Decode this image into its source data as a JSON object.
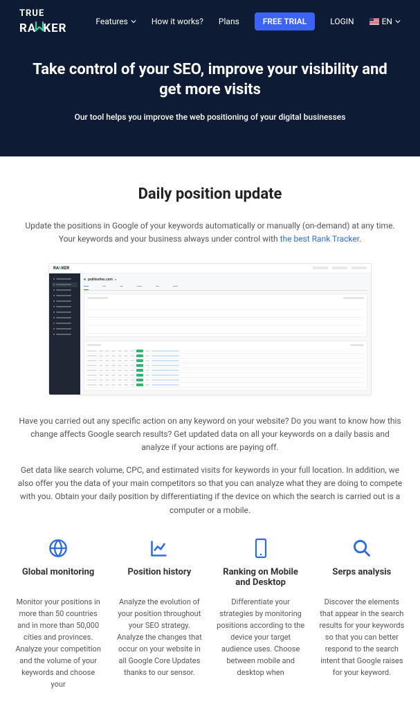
{
  "logo": {
    "line1": "TRUE",
    "line2": "RA",
    "line2b": "KER"
  },
  "nav": {
    "features": "Features",
    "how": "How it works?",
    "plans": "Plans",
    "trial": "FREE TRIAL",
    "login": "LOGIN",
    "lang": "EN"
  },
  "hero": {
    "title": "Take control of your SEO, improve your visibility and get more visits",
    "subtitle": "Our tool helps you improve the web positioning of your digital businesses"
  },
  "section": {
    "title": "Daily position update",
    "intro_1": "Update the positions in Google of your keywords automatically or manually (on-demand) at any time. Your keywords and your business always under control with ",
    "intro_link": "the best Rank Tracker",
    "intro_2": ".",
    "para1": "Have you carried out any specific action on any keyword on your website? Do you want to know how this change affects Google search results? Get updated data on all your keywords on a daily basis and analyze if your actions are paying off.",
    "para2": "Get data like search volume, CPC, and estimated visits for keywords in your full location. In addition, we also offer you the data of your main competitors so that you can analyze what they are doing to compete with you. Obtain your daily position by differentiating if the device on which the search is carried out is a computer or a mobile."
  },
  "dashboard": {
    "site": "publisuites.com"
  },
  "features": [
    {
      "title": "Global monitoring",
      "text": "Monitor your positions in more than 50 countries and in more than 50,000 cities and provinces. Analyze your competition and the volume of your keywords and choose your"
    },
    {
      "title": "Position history",
      "text": "Analyze the evolution of your position throughout your SEO strategy. Analyze the changes that occur on your website in all Google Core Updates thanks to our sensor."
    },
    {
      "title": "Ranking on Mobile and Desktop",
      "text": "Differentiate your strategies by monitoring positions according to the device your target audience uses. Choose between mobile and desktop when"
    },
    {
      "title": "Serps analysis",
      "text": "Discover the elements that appear in the search results for your keywords so that you can better respond to the search intent that Google raises for your keyword."
    }
  ]
}
